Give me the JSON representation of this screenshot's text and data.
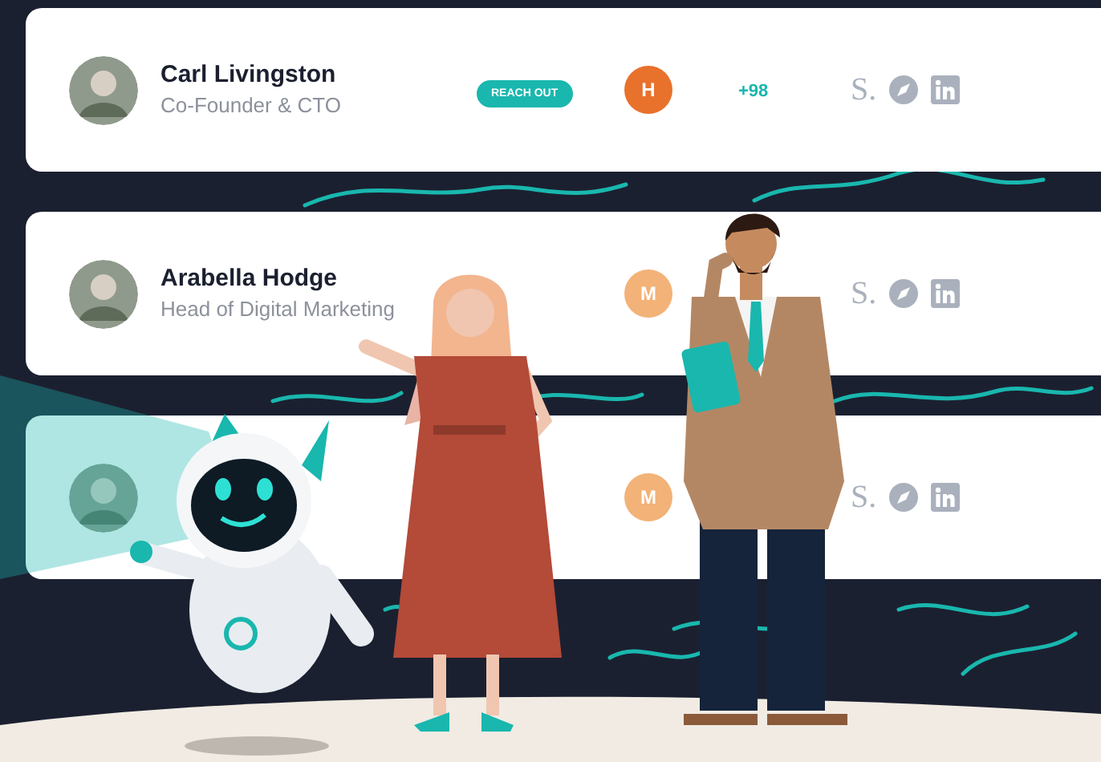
{
  "contacts": [
    {
      "name": "Carl Livingston",
      "title": "Co-Founder & CTO",
      "action": "REACH OUT",
      "badge": {
        "letter": "H",
        "color": "#e8712c"
      },
      "count": "+98",
      "logo": "S.",
      "highlighted": false
    },
    {
      "name": "Arabella Hodge",
      "title": "Head of Digital Marketing",
      "badge": {
        "letter": "M",
        "color": "#f3b277"
      },
      "logo": "S.",
      "highlighted": false
    },
    {
      "badge": {
        "letter": "M",
        "color": "#f3b277"
      },
      "logo": "S.",
      "highlighted": true
    }
  ]
}
